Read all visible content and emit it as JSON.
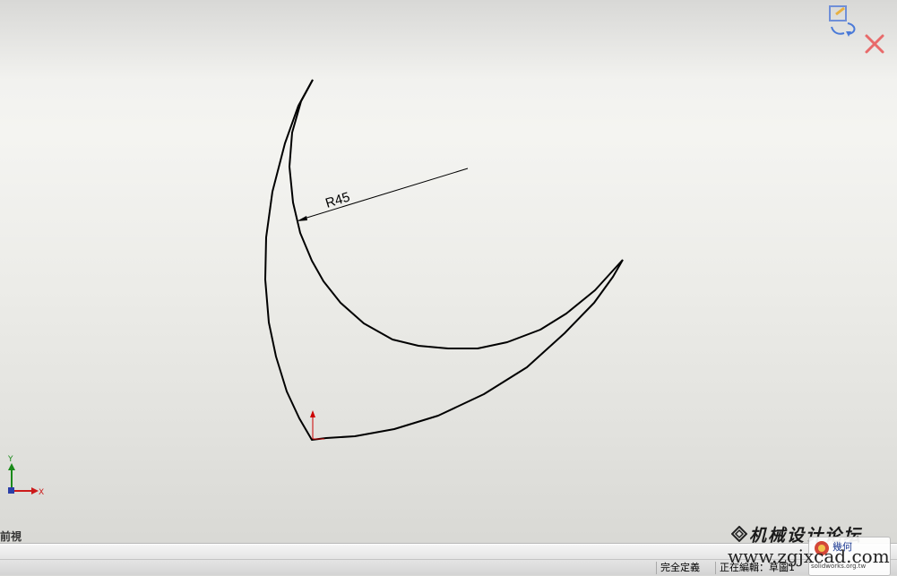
{
  "viewport": {
    "dimension": {
      "text": "R45"
    },
    "axis_triad": {
      "y_label": "Y",
      "x_label": "X"
    },
    "view_label": "前視",
    "corner_icons": [
      "rebuild-confirm-icon",
      "close-sketch-icon"
    ],
    "colors": {
      "sketch": "#000000",
      "origin_y": "#cc0000",
      "axis_y": "#1a8a1a",
      "axis_x": "#cc1a1a",
      "cancel": "#e86a6a",
      "confirm": "#4a7ad8"
    }
  },
  "status_bar": {
    "state": "完全定義",
    "editing": "正在編輯：草圖1"
  },
  "watermark": {
    "site_name": "机械设计论坛",
    "url": "www.zgjxcad.com",
    "logo_title": "幾何",
    "logo_site": "solidworks.org.tw"
  }
}
